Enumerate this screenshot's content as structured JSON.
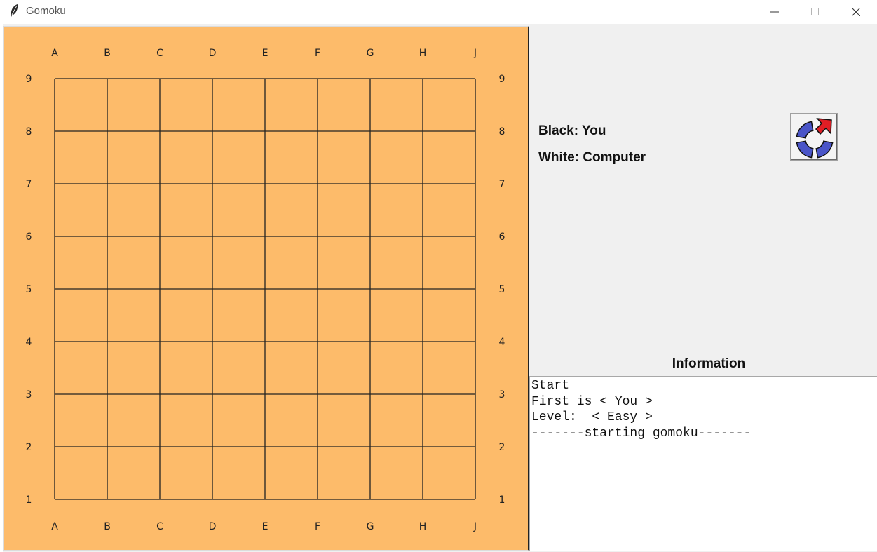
{
  "window": {
    "title": "Gomoku",
    "icon": "feather-icon",
    "controls": [
      "minimize-icon",
      "maximize-icon",
      "close-icon"
    ]
  },
  "board": {
    "background_color": "#fdbb6a",
    "line_color": "#222222",
    "columns": [
      "A",
      "B",
      "C",
      "D",
      "E",
      "F",
      "G",
      "H",
      "J"
    ],
    "rows": [
      "9",
      "8",
      "7",
      "6",
      "5",
      "4",
      "3",
      "2",
      "1"
    ],
    "stones": []
  },
  "players": {
    "black": "Black: You",
    "white": "White: Computer"
  },
  "restart_button": {
    "icon": "restart-arrow-icon",
    "colors": {
      "segments": "#4a55c8",
      "arrow": "#e01e25"
    }
  },
  "information": {
    "heading": "Information",
    "lines": [
      "Start",
      "First is < You >",
      "Level:  < Easy >",
      "-------starting gomoku-------"
    ]
  }
}
